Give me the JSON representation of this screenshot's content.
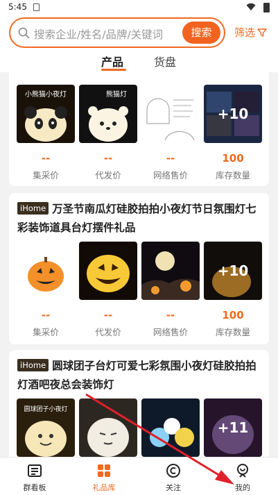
{
  "status": {
    "time": "5:45"
  },
  "search": {
    "placeholder": "搜索企业/姓名/品牌/关键词",
    "button": "搜索",
    "filter": "筛选"
  },
  "tabs": [
    {
      "label": "产品"
    },
    {
      "label": "货盘"
    }
  ],
  "cards": [
    {
      "badge": "",
      "title": "",
      "thumb_labels": [
        "小熊猫小夜灯",
        "熊猫灯"
      ],
      "more_count": "+10",
      "stats": [
        {
          "value": "--",
          "label": "集采价"
        },
        {
          "value": "--",
          "label": "代发价"
        },
        {
          "value": "--",
          "label": "网络售价"
        },
        {
          "value": "100",
          "label": "库存数量"
        }
      ]
    },
    {
      "badge": "iHome",
      "title": "万圣节南瓜灯硅胶拍拍小夜灯节日氛围灯七彩装饰道具台灯摆件礼品",
      "more_count": "+10",
      "stats": [
        {
          "value": "--",
          "label": "集采价"
        },
        {
          "value": "--",
          "label": "代发价"
        },
        {
          "value": "--",
          "label": "网络售价"
        },
        {
          "value": "100",
          "label": "库存数量"
        }
      ]
    },
    {
      "badge": "iHome",
      "title": "圆球团子台灯可爱七彩氛围小夜灯硅胶拍拍灯酒吧夜总会装饰灯",
      "thumb_labels": [
        "圆球团子小夜灯"
      ],
      "more_count": "+11"
    }
  ],
  "bottom_nav": [
    {
      "label": "群看板",
      "icon": "board-icon"
    },
    {
      "label": "礼品库",
      "icon": "gift-grid-icon",
      "active": true
    },
    {
      "label": "关注",
      "icon": "follow-icon"
    },
    {
      "label": "我的",
      "icon": "profile-icon"
    }
  ],
  "colors": {
    "accent": "#ef6a1f",
    "annotation": "#e0202a"
  }
}
